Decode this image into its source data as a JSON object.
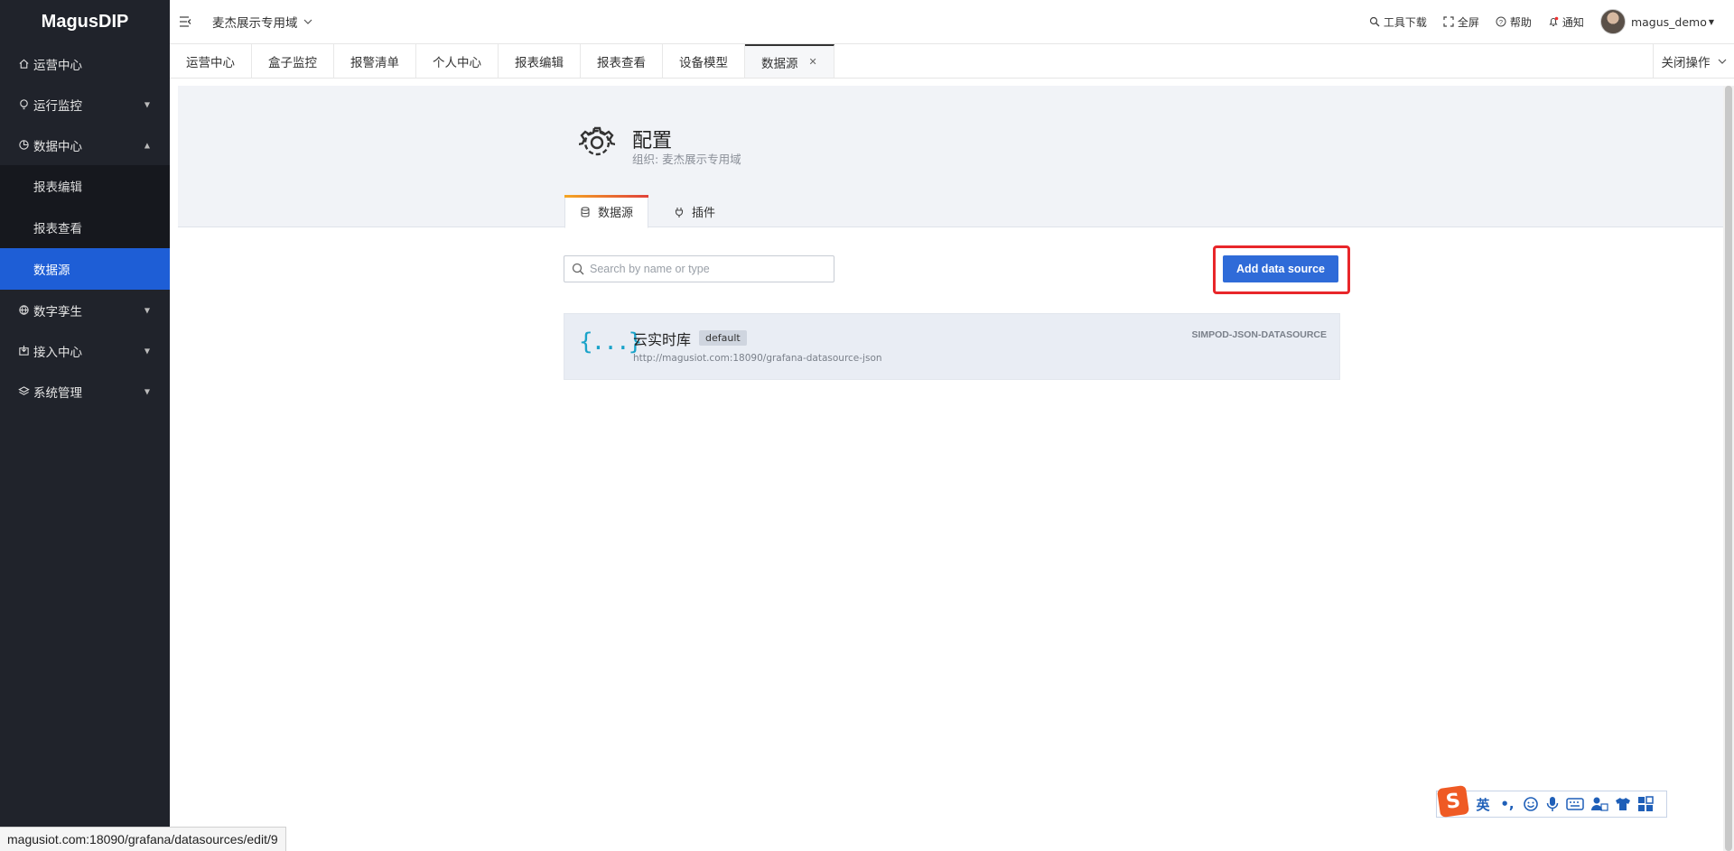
{
  "app": {
    "logo": "MagusDIP"
  },
  "sidebar": {
    "items": [
      {
        "label": "运营中心",
        "icon": "home-icon"
      },
      {
        "label": "运行监控",
        "icon": "bulb-icon",
        "caret": "▼"
      },
      {
        "label": "数据中心",
        "icon": "pie-icon",
        "caret": "▲"
      },
      {
        "label": "数字孪生",
        "icon": "globe-icon",
        "caret": "▼"
      },
      {
        "label": "接入中心",
        "icon": "import-icon",
        "caret": "▼"
      },
      {
        "label": "系统管理",
        "icon": "layers-icon",
        "caret": "▼"
      }
    ],
    "sub_items": [
      {
        "label": "报表编辑"
      },
      {
        "label": "报表查看"
      },
      {
        "label": "数据源",
        "active": true
      }
    ],
    "active_color": "#1e5ed6"
  },
  "topbar": {
    "org": "麦杰展示专用域",
    "tools": "工具下载",
    "fullscreen": "全屏",
    "help": "帮助",
    "notify": "通知",
    "user": "magus_demo"
  },
  "tabs": {
    "items": [
      "运营中心",
      "盒子监控",
      "报警清单",
      "个人中心",
      "报表编辑",
      "报表查看",
      "设备模型",
      "数据源"
    ],
    "active": "数据源",
    "close_ops": "关闭操作"
  },
  "config": {
    "title": "配置",
    "subtitle": "组织: 麦杰展示专用域",
    "page_tabs": [
      "数据源",
      "插件"
    ],
    "search_placeholder": "Search by name or type",
    "add_button": "Add data source",
    "highlight_color": "#e8262a"
  },
  "datasources": [
    {
      "icon": "{...}",
      "name": "云实时库",
      "badge": "default",
      "url": "http://magusiot.com:18090/grafana-datasource-json",
      "type": "SIMPOD-JSON-DATASOURCE"
    }
  ],
  "status_bar": {
    "url": "magusiot.com:18090/grafana/datasources/edit/9"
  },
  "ime": {
    "logo": "S",
    "lang": "英",
    "punct": "•,"
  }
}
